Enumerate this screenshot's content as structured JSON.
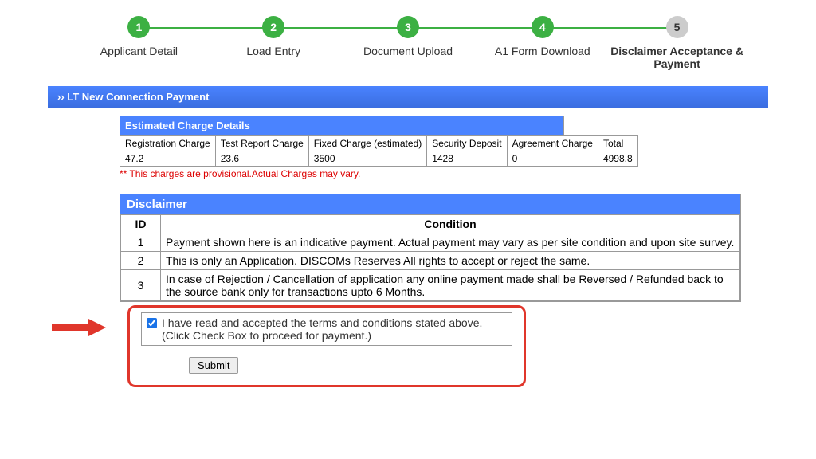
{
  "stepper": {
    "steps": [
      {
        "num": "1",
        "label": "Applicant Detail"
      },
      {
        "num": "2",
        "label": "Load Entry"
      },
      {
        "num": "3",
        "label": "Document Upload"
      },
      {
        "num": "4",
        "label": "A1 Form Download"
      },
      {
        "num": "5",
        "label": "Disclaimer Acceptance & Payment"
      }
    ]
  },
  "section_title": "››  LT New Connection Payment",
  "estimated": {
    "header": "Estimated Charge Details",
    "columns": [
      "Registration Charge",
      "Test Report Charge",
      "Fixed Charge (estimated)",
      "Security Deposit",
      "Agreement Charge",
      "Total"
    ],
    "values": [
      "47.2",
      "23.6",
      "3500",
      "1428",
      "0",
      "4998.8"
    ],
    "note": "** This charges are provisional.Actual Charges may vary."
  },
  "disclaimer": {
    "header": "Disclaimer",
    "id_col": "ID",
    "cond_col": "Condition",
    "rows": [
      {
        "id": "1",
        "text": "Payment shown here is an indicative payment. Actual payment may vary as per site condition and upon site survey."
      },
      {
        "id": "2",
        "text": "This is only an Application. DISCOMs Reserves All rights to accept or reject the same."
      },
      {
        "id": "3",
        "text": "In case of Rejection / Cancellation of application any online payment made shall be Reversed / Refunded back to the source bank only for transactions upto 6 Months."
      }
    ]
  },
  "accept": {
    "text": "I have read and accepted the terms and conditions stated above.\n(Click Check Box to proceed for payment.)",
    "button": "Submit"
  }
}
